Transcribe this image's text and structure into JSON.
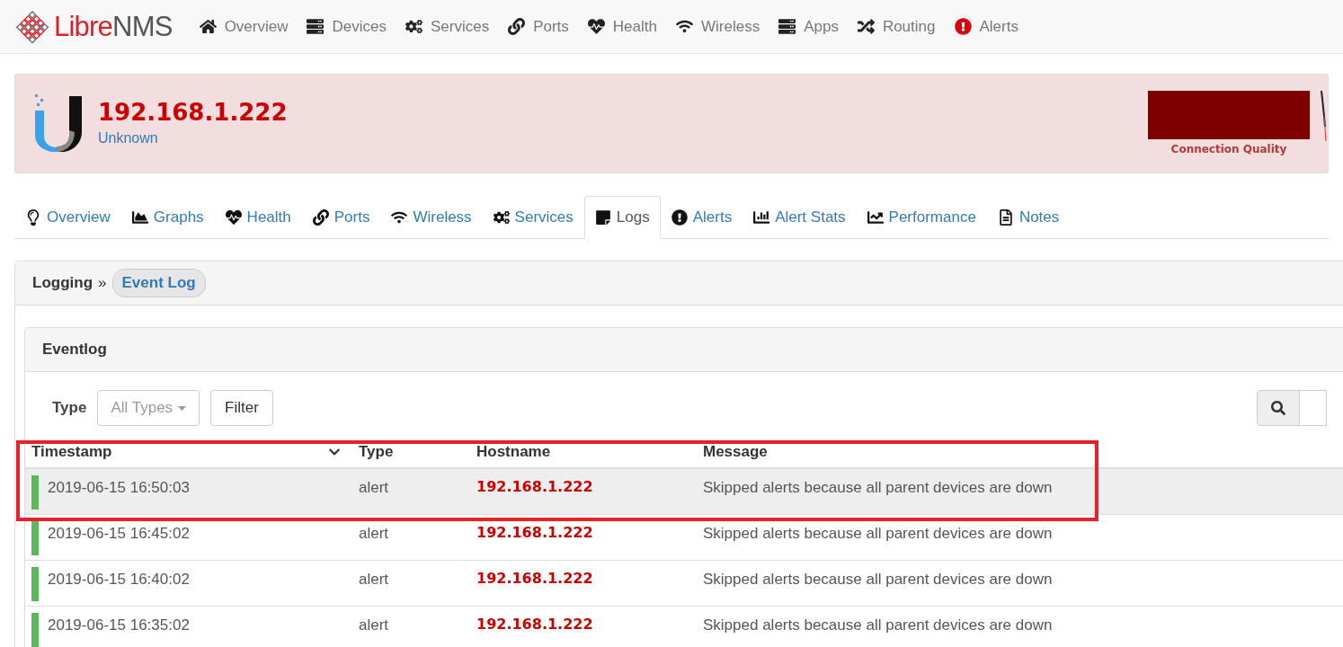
{
  "brand": {
    "part_1": "Libre",
    "part_2": "NMS"
  },
  "nav": [
    {
      "label": "Overview"
    },
    {
      "label": "Devices"
    },
    {
      "label": "Services"
    },
    {
      "label": "Ports"
    },
    {
      "label": "Health"
    },
    {
      "label": "Wireless"
    },
    {
      "label": "Apps"
    },
    {
      "label": "Routing"
    },
    {
      "label": "Alerts"
    }
  ],
  "device": {
    "hostname": "192.168.1.222",
    "hardware": "Unknown",
    "graph_label": "Connection Quality"
  },
  "tabs": [
    {
      "label": "Overview",
      "selected": false
    },
    {
      "label": "Graphs",
      "selected": false
    },
    {
      "label": "Health",
      "selected": false
    },
    {
      "label": "Ports",
      "selected": false
    },
    {
      "label": "Wireless",
      "selected": false
    },
    {
      "label": "Services",
      "selected": false
    },
    {
      "label": "Logs",
      "selected": true
    },
    {
      "label": "Alerts",
      "selected": false
    },
    {
      "label": "Alert Stats",
      "selected": false
    },
    {
      "label": "Performance",
      "selected": false
    },
    {
      "label": "Notes",
      "selected": false
    }
  ],
  "breadcrumb": {
    "parent": "Logging",
    "separator": "»",
    "current": "Event Log"
  },
  "eventlog": {
    "title": "Eventlog",
    "filter_label": "Type",
    "type_select": "All Types",
    "filter_button": "Filter",
    "columns": [
      "Timestamp",
      "Type",
      "Hostname",
      "Message"
    ],
    "rows": [
      {
        "timestamp": "2019-06-15 16:50:03",
        "type": "alert",
        "hostname": "192.168.1.222",
        "message": "Skipped alerts because all parent devices are down",
        "color": "#5cb85c",
        "highlighted": true
      },
      {
        "timestamp": "2019-06-15 16:45:02",
        "type": "alert",
        "hostname": "192.168.1.222",
        "message": "Skipped alerts because all parent devices are down",
        "color": "#5cb85c",
        "highlighted": false
      },
      {
        "timestamp": "2019-06-15 16:40:02",
        "type": "alert",
        "hostname": "192.168.1.222",
        "message": "Skipped alerts because all parent devices are down",
        "color": "#5cb85c",
        "highlighted": false
      },
      {
        "timestamp": "2019-06-15 16:35:02",
        "type": "alert",
        "hostname": "192.168.1.222",
        "message": "Skipped alerts because all parent devices are down",
        "color": "#5cb85c",
        "highlighted": false
      }
    ]
  },
  "annotation": {
    "frame": true
  }
}
